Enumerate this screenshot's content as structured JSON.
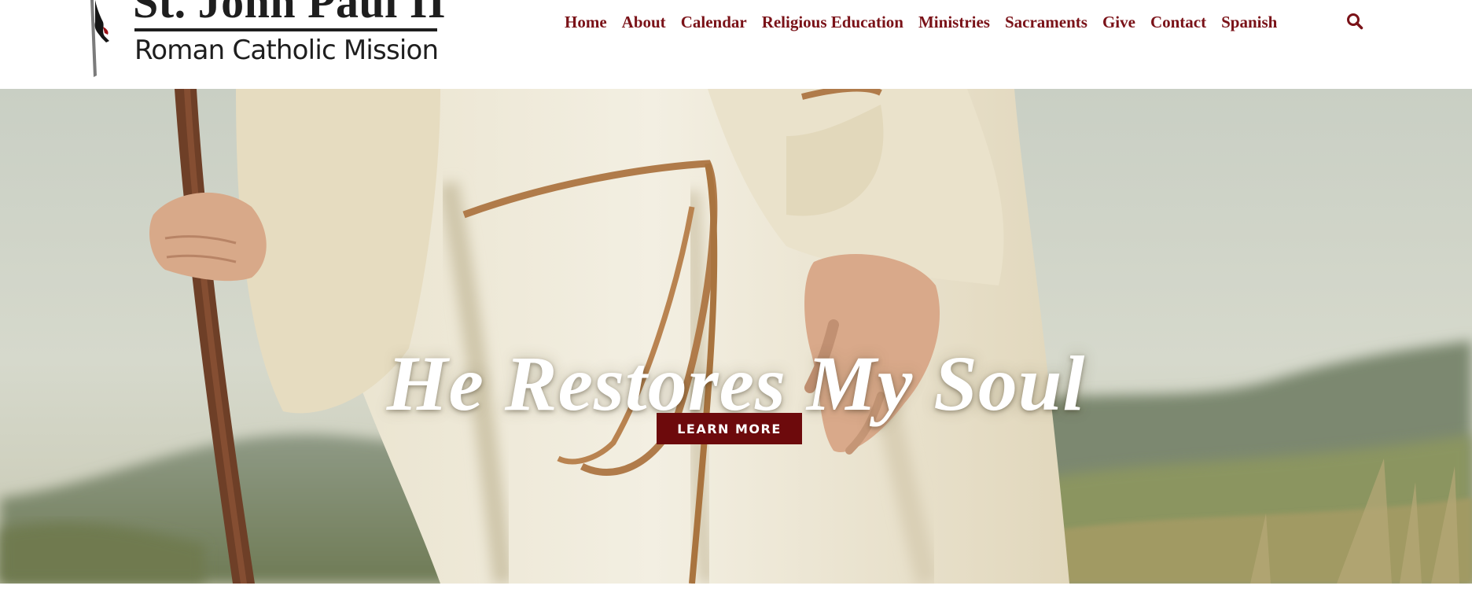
{
  "site": {
    "logo_title": "St. John Paul II",
    "logo_subtitle": "Roman Catholic Mission"
  },
  "nav": {
    "items": [
      {
        "label": "Home"
      },
      {
        "label": "About"
      },
      {
        "label": "Calendar"
      },
      {
        "label": "Religious Education"
      },
      {
        "label": "Ministries"
      },
      {
        "label": "Sacraments"
      },
      {
        "label": "Give"
      },
      {
        "label": "Contact"
      },
      {
        "label": "Spanish"
      }
    ],
    "search_icon": "search-icon"
  },
  "hero": {
    "title": "He Restores My Soul",
    "button_label": "LEARN MORE",
    "image": "robed-figure-with-staff-in-field"
  },
  "colors": {
    "brand": "#7a1218",
    "button": "#6d0a0c",
    "text_dark": "#1e1e1e",
    "background": "#ffffff"
  }
}
